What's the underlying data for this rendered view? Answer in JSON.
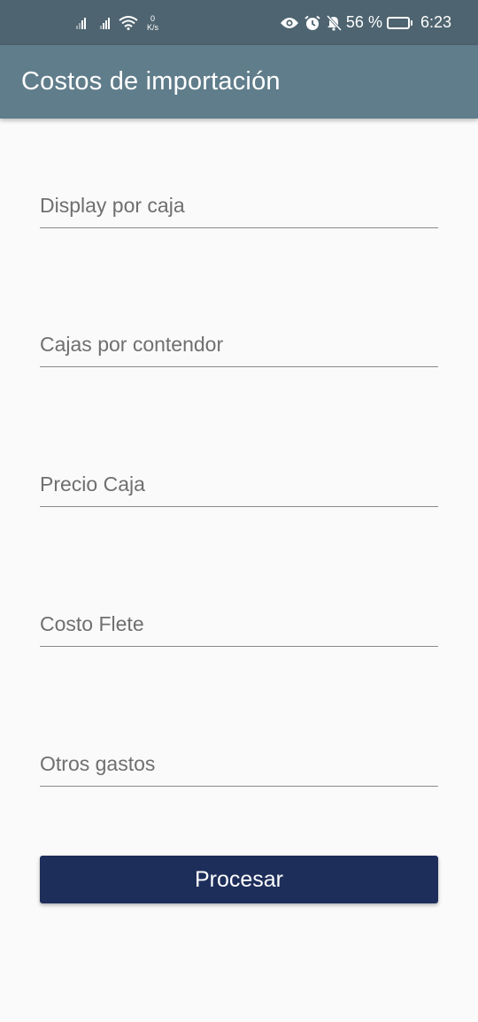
{
  "status_bar": {
    "net_speed_value": "0",
    "net_speed_unit": "K/s",
    "battery_percent": "56 %",
    "battery_level": 0.56,
    "time": "6:23",
    "icons": [
      "signal-icon",
      "signal-icon",
      "wifi-icon",
      "eye-icon",
      "alarm-icon",
      "mute-icon",
      "battery-icon"
    ]
  },
  "app_bar": {
    "title": "Costos de importación"
  },
  "form": {
    "fields": [
      {
        "placeholder": "Display por caja",
        "value": ""
      },
      {
        "placeholder": "Cajas por contendor",
        "value": ""
      },
      {
        "placeholder": "Precio Caja",
        "value": ""
      },
      {
        "placeholder": "Costo Flete",
        "value": ""
      },
      {
        "placeholder": "Otros gastos",
        "value": ""
      }
    ],
    "submit_label": "Procesar"
  },
  "colors": {
    "status_bar": "#4e6470",
    "app_bar": "#607d8b",
    "button": "#1e2e5b",
    "background": "#fafafa"
  }
}
